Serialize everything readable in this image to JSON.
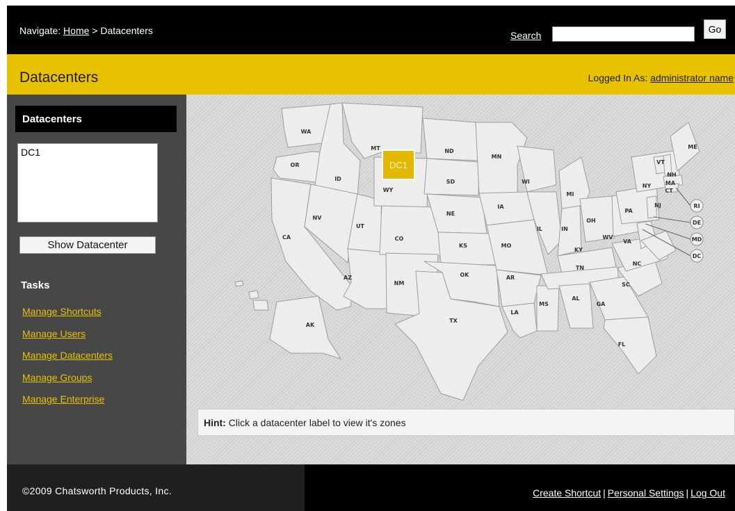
{
  "nav": {
    "prefix": "Navigate: ",
    "home": "Home",
    "separator": " > ",
    "current": "Datacenters"
  },
  "search": {
    "label": "Search",
    "value": "",
    "button": "Go"
  },
  "header": {
    "title": "Datacenters",
    "logged_in_label": "Logged In As: ",
    "user": "administrator name"
  },
  "sidebar": {
    "title": "Datacenters",
    "datacenters": [
      "DC1"
    ],
    "show_button": "Show Datacenter",
    "tasks_title": "Tasks",
    "tasks": [
      "Manage Shortcuts",
      "Manage Users",
      "Manage Datacenters",
      "Manage Groups",
      "Manage Enterprise"
    ]
  },
  "map": {
    "datacenter_marker": "DC1",
    "marker_color": "#e3b800",
    "states": [
      "WA",
      "OR",
      "CA",
      "ID",
      "NV",
      "UT",
      "AZ",
      "MT",
      "WY",
      "CO",
      "NM",
      "ND",
      "SD",
      "NE",
      "KS",
      "OK",
      "TX",
      "MN",
      "IA",
      "MO",
      "AR",
      "LA",
      "WI",
      "IL",
      "MS",
      "MI",
      "IN",
      "KY",
      "TN",
      "AL",
      "OH",
      "GA",
      "FL",
      "SC",
      "NC",
      "WV",
      "VA",
      "PA",
      "NY",
      "VT",
      "NH",
      "ME",
      "MA",
      "CT",
      "NJ",
      "AK"
    ],
    "callouts": [
      "RI",
      "DE",
      "MD",
      "DC"
    ],
    "hint_label": "Hint:",
    "hint_text": " Click a datacenter label to view it's zones"
  },
  "footer": {
    "copyright": "©2009 Chatsworth Products, Inc.",
    "links": [
      "Create Shortcut",
      "Personal Settings",
      "Log Out"
    ]
  },
  "colors": {
    "accent": "#e8c100",
    "topbar": "#000000",
    "sidebar": "#474747"
  }
}
